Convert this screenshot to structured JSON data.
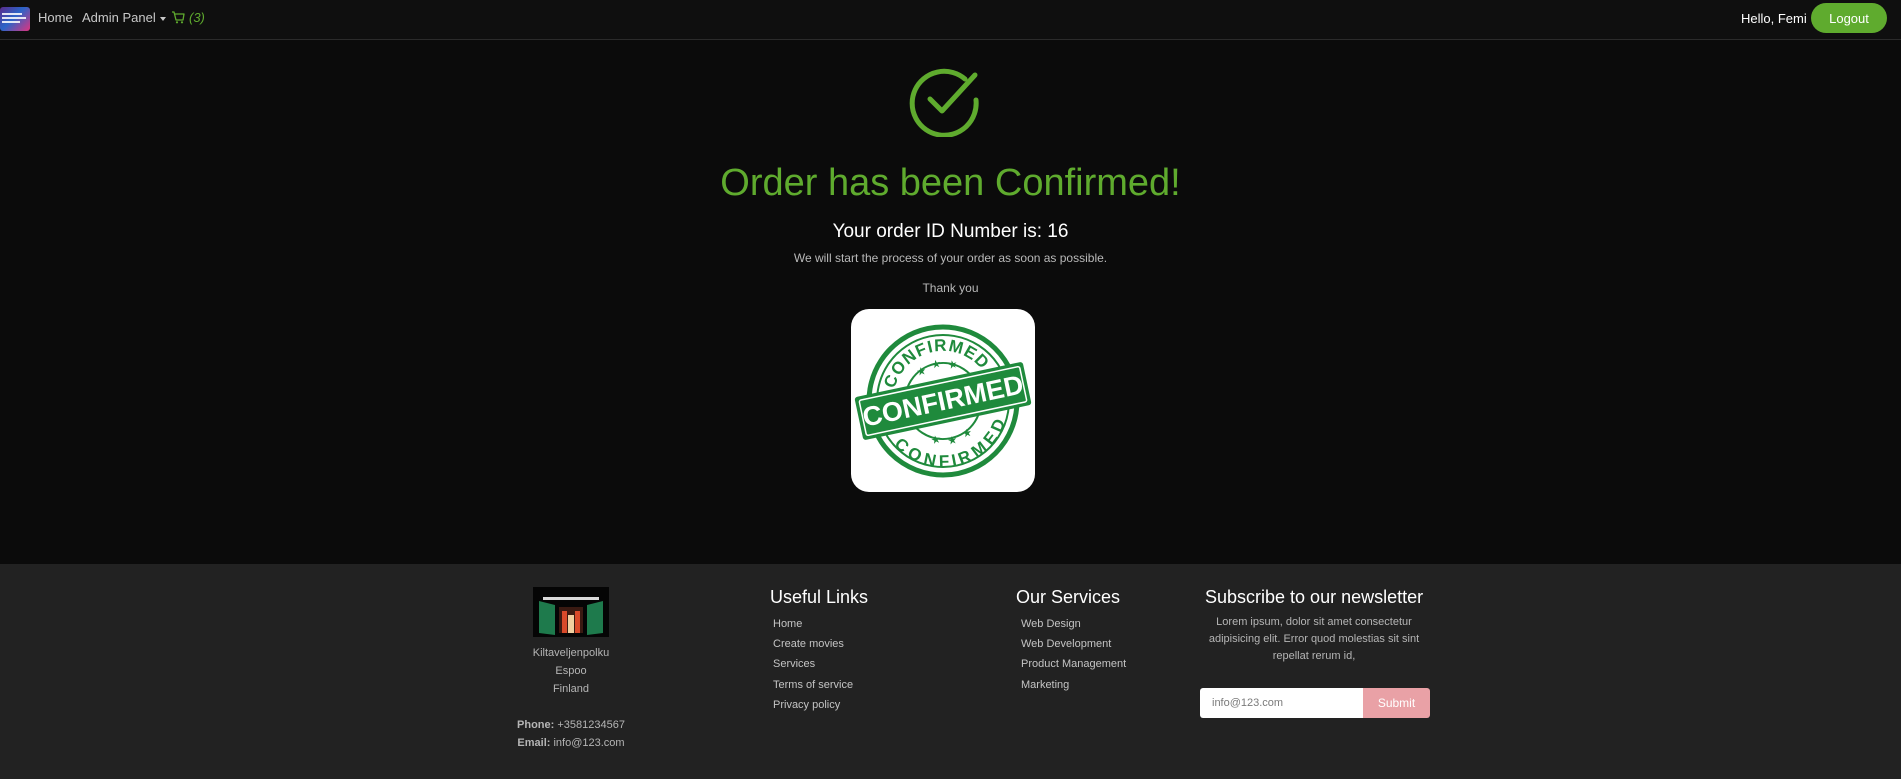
{
  "navbar": {
    "home_label": "Home",
    "admin_label": "Admin Panel",
    "cart_count": "(3)",
    "greeting": "Hello, Femi",
    "logout_label": "Logout"
  },
  "main": {
    "title": "Order has been Confirmed!",
    "order_id_text": "Your order ID Number is: 16",
    "note": "We will start the process of your order as soon as possible.",
    "thank_you": "Thank you",
    "stamp": {
      "top_text": "CONFIRMED",
      "band_text": "CONFIRMED",
      "bottom_text": "CONFIRMED"
    }
  },
  "footer": {
    "address": {
      "street": "Kiltaveljenpolku",
      "city": "Espoo",
      "country": "Finland"
    },
    "phone_label": "Phone:",
    "phone_value": "+3581234567",
    "email_label": "Email:",
    "email_value": "info@123.com",
    "useful_links": {
      "title": "Useful Links",
      "items": [
        "Home",
        "Create movies",
        "Services",
        "Terms of service",
        "Privacy policy"
      ]
    },
    "services": {
      "title": "Our Services",
      "items": [
        "Web Design",
        "Web Development",
        "Product Management",
        "Marketing"
      ]
    },
    "newsletter": {
      "title": "Subscribe to our newsletter",
      "text": "Lorem ipsum, dolor sit amet consectetur adipisicing elit. Error quod molestias sit sint repellat rerum id,",
      "placeholder": "info@123.com",
      "submit_label": "Submit"
    }
  },
  "colors": {
    "accent_green": "#5fab2e",
    "stamp_green": "#1f8a3c",
    "submit_pink": "#e9a1a6",
    "background": "#0b0b0b",
    "footer_bg": "#222222"
  }
}
